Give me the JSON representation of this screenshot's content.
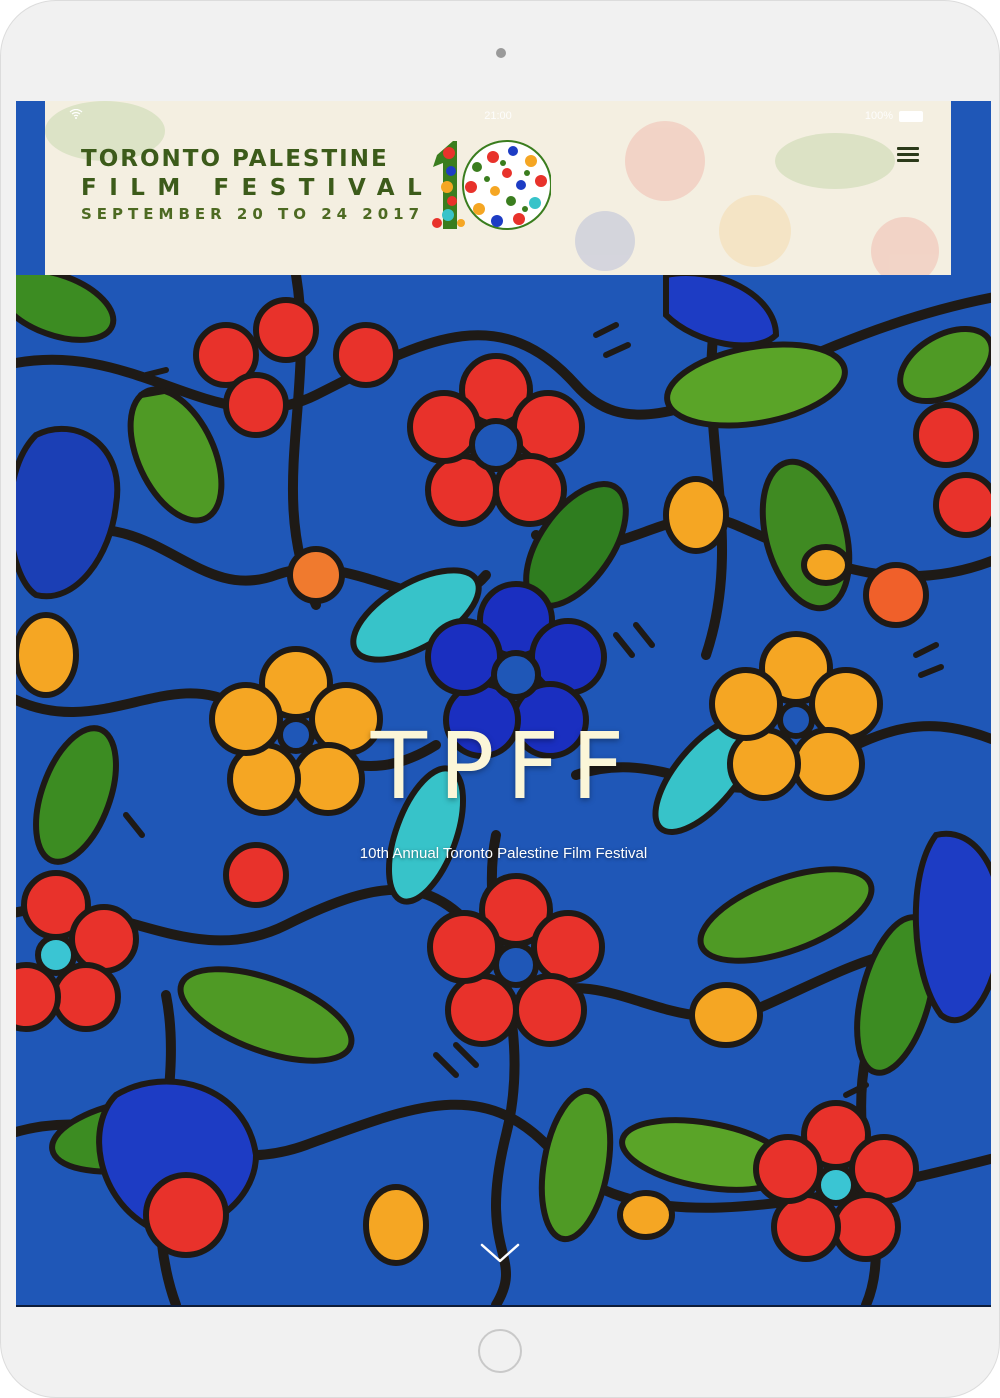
{
  "status_bar": {
    "time": "21:00",
    "battery": "100%"
  },
  "header": {
    "logo_line1": "TORONTO PALESTINE",
    "logo_line2": "FILM FESTIVAL",
    "logo_line3": "SEPTEMBER 20 TO 24 2017",
    "logo_emblem": "10"
  },
  "hero": {
    "title": "TPFF",
    "subtitle": "10th Annual Toronto Palestine Film Festival"
  },
  "icons": {
    "menu": "hamburger-menu-icon",
    "scroll": "chevron-down-icon"
  },
  "colors": {
    "header_bg": "#f4efe1",
    "logo_green": "#3c5b1a",
    "hero_blue": "#1f57b7",
    "title_cream": "#fbf6d8"
  }
}
